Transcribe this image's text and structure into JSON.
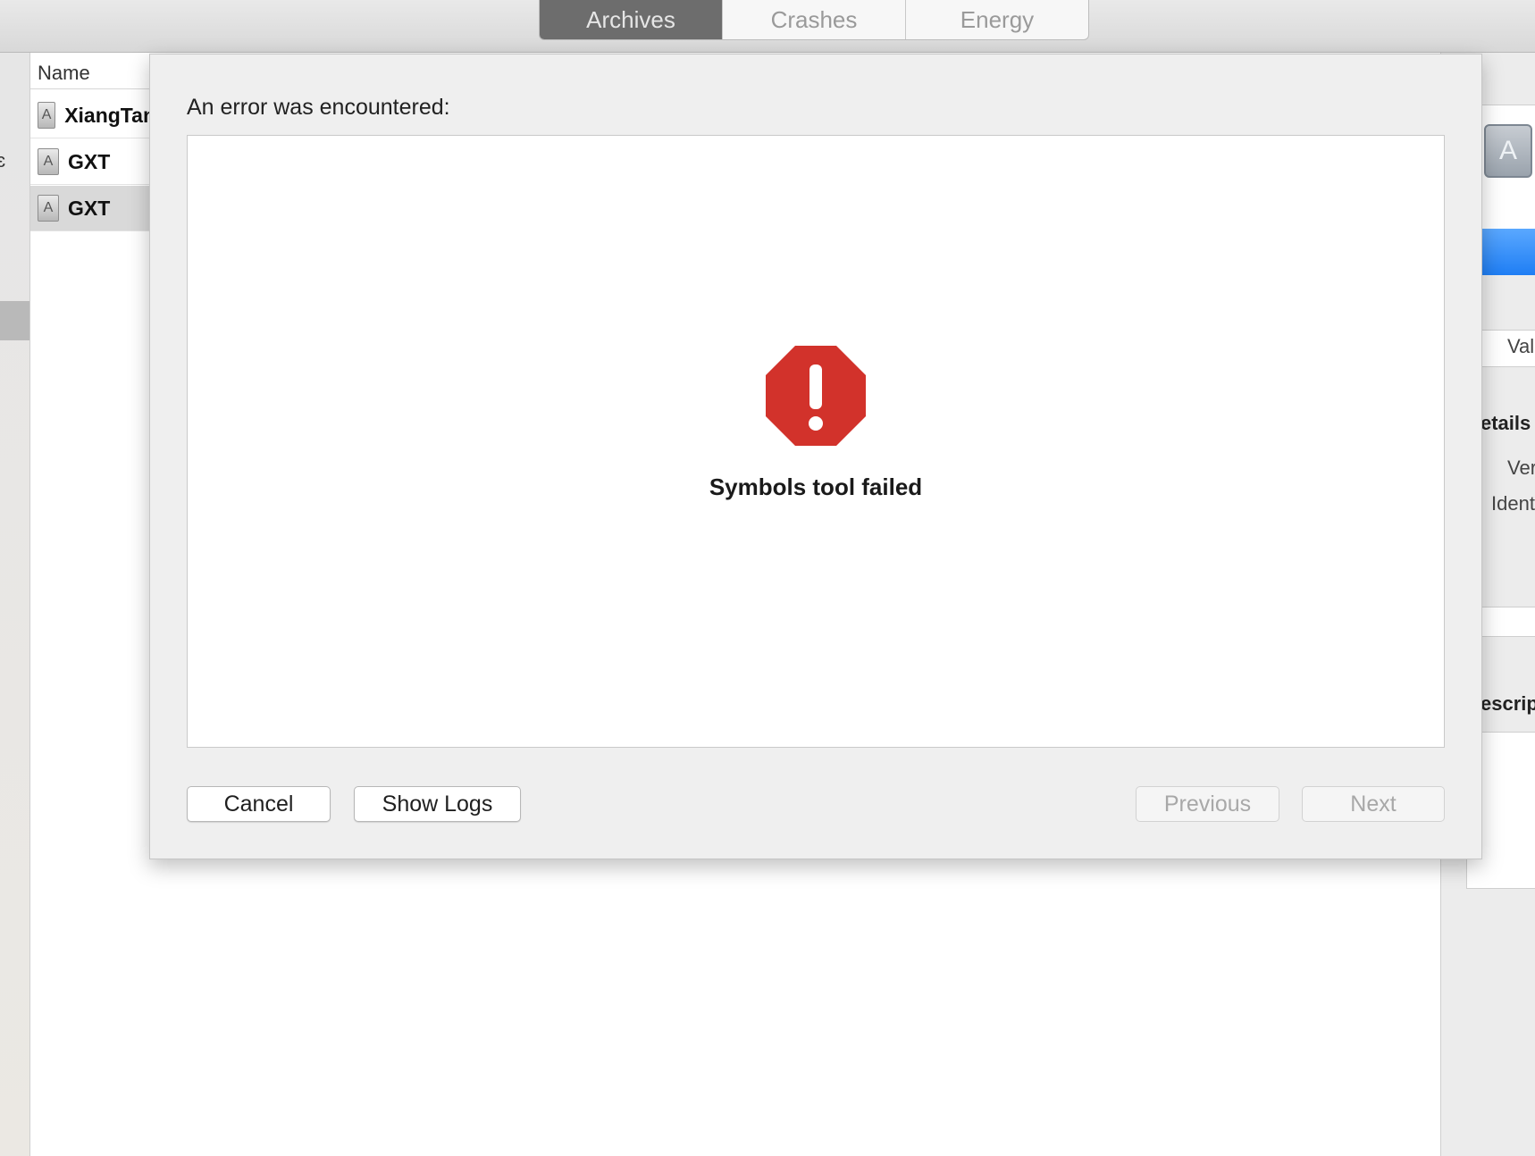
{
  "toolbar": {
    "tabs": [
      {
        "label": "Archives",
        "active": true
      },
      {
        "label": "Crashes",
        "active": false
      },
      {
        "label": "Energy",
        "active": false
      }
    ]
  },
  "list": {
    "header": "Name",
    "rows": [
      {
        "label": "XiangTan"
      },
      {
        "label": "GXT"
      },
      {
        "label": "GXT"
      }
    ]
  },
  "inspector": {
    "partial_labels": [
      "Val",
      "etails",
      "Ver",
      "Ident",
      "escrip"
    ]
  },
  "dialog": {
    "title": "An error was encountered:",
    "message": "Symbols tool failed",
    "buttons": {
      "cancel": "Cancel",
      "show_logs": "Show Logs",
      "previous": "Previous",
      "next": "Next"
    }
  },
  "colors": {
    "error_red": "#d2322b",
    "active_tab": "#6d6d6d",
    "selection_blue": "#1f7ef4"
  }
}
